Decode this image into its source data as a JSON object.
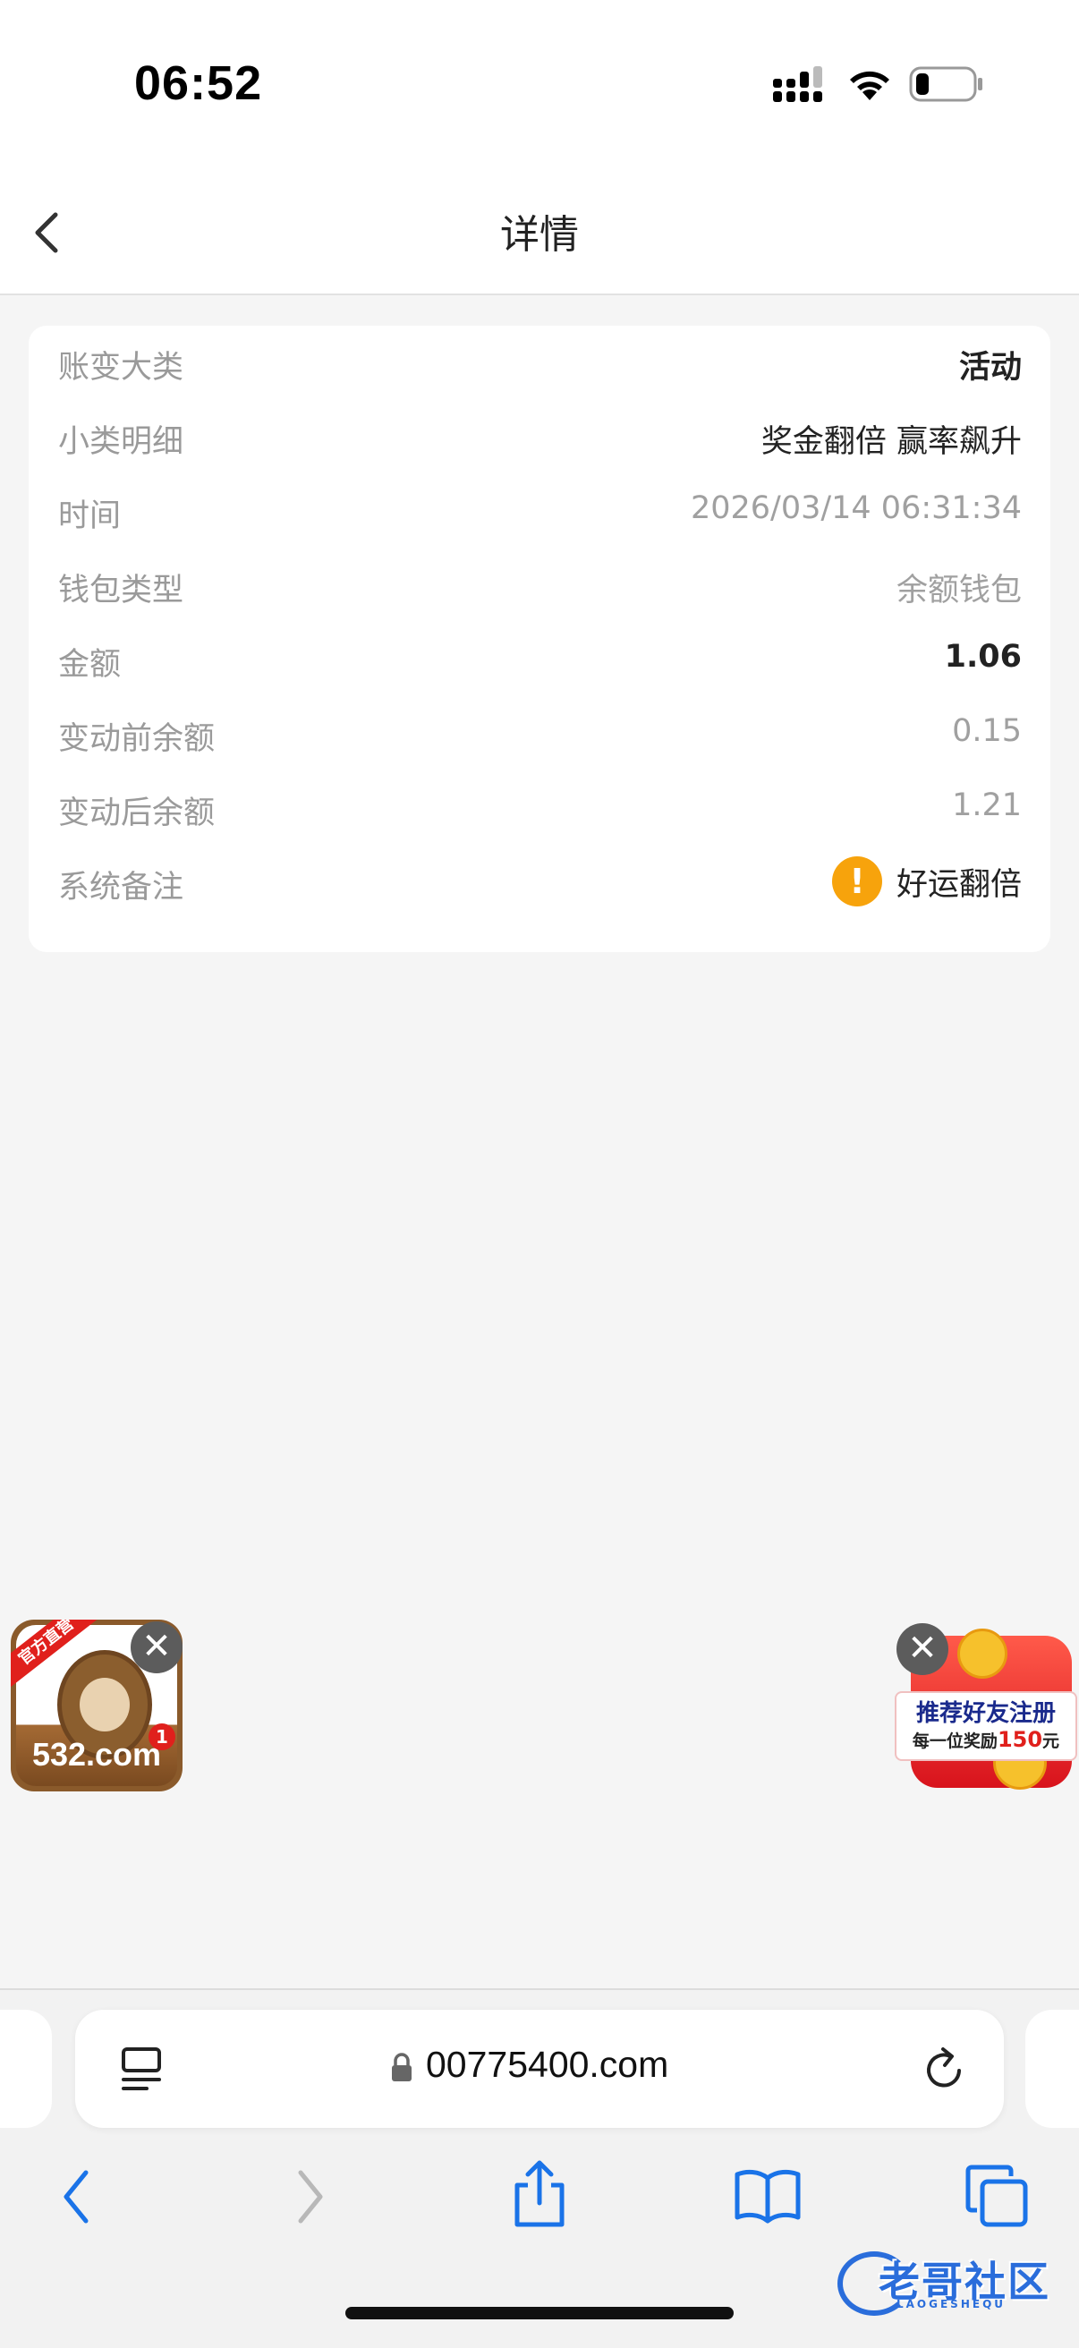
{
  "status_bar": {
    "time": "06:52"
  },
  "nav": {
    "title": "详情"
  },
  "details": {
    "rows": [
      {
        "label": "账变大类",
        "value": "活动"
      },
      {
        "label": "小类明细",
        "value": "奖金翻倍 赢率飙升"
      },
      {
        "label": "时间",
        "value": "2026/03/14 06:31:34"
      },
      {
        "label": "钱包类型",
        "value": "余额钱包"
      },
      {
        "label": "金额",
        "value": "1.06"
      },
      {
        "label": "变动前余额",
        "value": "0.15"
      },
      {
        "label": "变动后余额",
        "value": "1.21"
      },
      {
        "label": "系统备注",
        "value": "好运翻倍",
        "icon": "warning-icon",
        "icon_color": "#f7a30c"
      }
    ]
  },
  "float_ads": {
    "left": {
      "ribbon": "官方直营",
      "site": "532.com",
      "badge": "1",
      "close": "✕"
    },
    "right": {
      "line1": "推荐好友注册",
      "line2_prefix": "每一位奖励",
      "line2_amount": "150",
      "line2_suffix": "元",
      "close": "✕"
    }
  },
  "browser": {
    "url": "00775400.com",
    "accent_color": "#1a73e8"
  },
  "watermark": {
    "text": "老哥社区",
    "sub": "LAOGESHEQU"
  }
}
